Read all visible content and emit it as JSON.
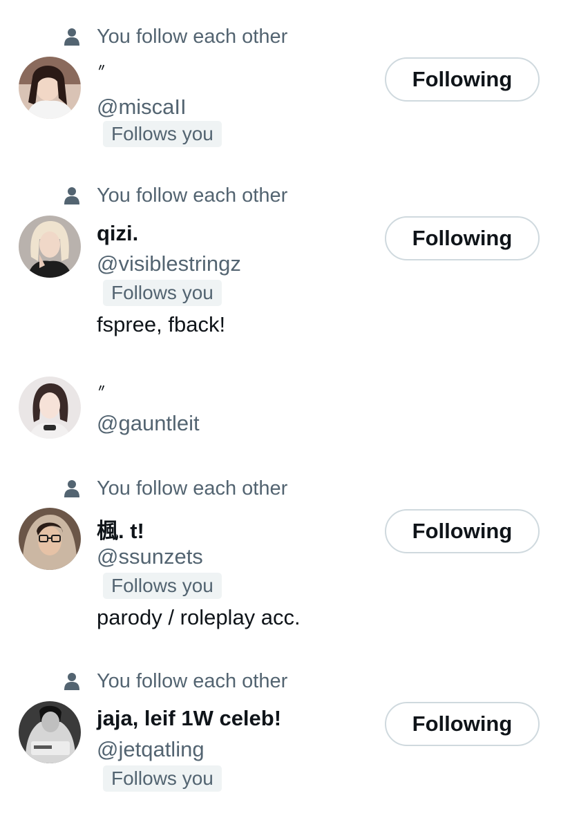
{
  "social_context_text": "You follow each other",
  "follows_you_text": "Follows you",
  "following_button_label": "Following",
  "users": [
    {
      "display_name": "〃",
      "handle": "@miscaII",
      "bio": "",
      "avatar_icon": "avatar-photo"
    },
    {
      "display_name": "qizi.",
      "handle": "@visiblestringz",
      "bio": "fspree, fback!",
      "avatar_icon": "avatar-photo"
    },
    {
      "display_name": "〃",
      "handle": "@gauntleit",
      "bio": "",
      "avatar_icon": "avatar-photo"
    },
    {
      "display_name": "楓. t!",
      "handle": "@ssunzets",
      "bio": "parody / roleplay acc.",
      "avatar_icon": "avatar-photo"
    },
    {
      "display_name": "jaja, leif 1W celeb!",
      "handle": "@jetqatling",
      "bio": "",
      "avatar_icon": "avatar-photo"
    }
  ],
  "colors": {
    "primary_text": "#0f1419",
    "secondary_text": "#536471",
    "badge_bg": "#eff3f4",
    "button_border": "#cfd9de"
  },
  "icons": {
    "social_context": "person-icon"
  }
}
